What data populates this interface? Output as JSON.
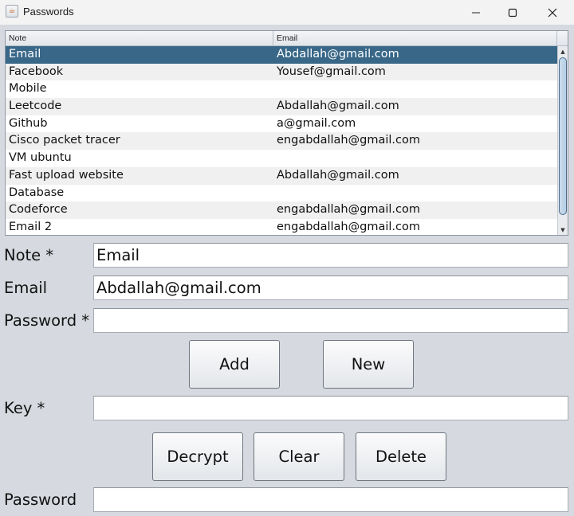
{
  "window": {
    "title": "Passwords",
    "icon": "java-cup-icon",
    "controls": {
      "minimize": "minimize-icon",
      "maximize": "maximize-icon",
      "close": "close-icon"
    }
  },
  "table": {
    "columns": [
      "Note",
      "Email"
    ],
    "selected_index": 0,
    "rows": [
      {
        "note": "Email",
        "email": "Abdallah@gmail.com"
      },
      {
        "note": "Facebook",
        "email": "Yousef@gmail.com"
      },
      {
        "note": "Mobile",
        "email": ""
      },
      {
        "note": "Leetcode",
        "email": "Abdallah@gmail.com"
      },
      {
        "note": "Github",
        "email": "a@gmail.com"
      },
      {
        "note": "Cisco packet tracer",
        "email": "engabdallah@gmail.com"
      },
      {
        "note": "VM ubuntu",
        "email": ""
      },
      {
        "note": "Fast upload website",
        "email": "Abdallah@gmail.com"
      },
      {
        "note": "Database",
        "email": ""
      },
      {
        "note": "Codeforce",
        "email": "engabdallah@gmail.com"
      },
      {
        "note": "Email 2",
        "email": "engabdallah@gmail.com"
      }
    ],
    "scrollbar": {
      "up": "▲",
      "down": "▼"
    }
  },
  "form": {
    "note_label": "Note *",
    "note_value": "Email",
    "email_label": "Email",
    "email_value": "Abdallah@gmail.com",
    "password_label": "Password *",
    "password_value": "",
    "add_label": "Add",
    "new_label": "New",
    "key_label": "Key *",
    "key_value": "",
    "decrypt_label": "Decrypt",
    "clear_label": "Clear",
    "delete_label": "Delete",
    "result_label": "Password",
    "result_value": ""
  }
}
